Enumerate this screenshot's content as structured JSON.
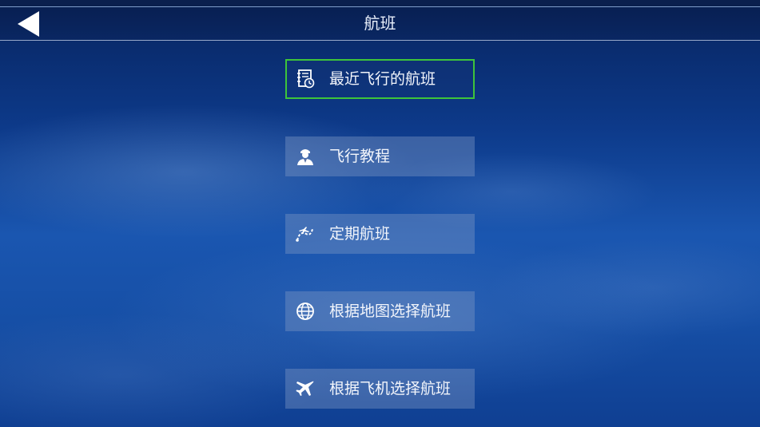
{
  "header": {
    "title": "航班",
    "back_icon": "back-arrow-icon"
  },
  "menu": {
    "items": [
      {
        "label": "最近飞行的航班",
        "icon": "recent-flights-log-icon",
        "selected": true
      },
      {
        "label": "飞行教程",
        "icon": "pilot-icon",
        "selected": false
      },
      {
        "label": "定期航班",
        "icon": "flight-route-icon",
        "selected": false
      },
      {
        "label": "根据地图选择航班",
        "icon": "globe-icon",
        "selected": false
      },
      {
        "label": "根据飞机选择航班",
        "icon": "airplane-icon",
        "selected": false
      }
    ]
  },
  "colors": {
    "selection_border": "#3ec43a",
    "item_background": "#7d96c3",
    "text": "#f2f5fb"
  }
}
